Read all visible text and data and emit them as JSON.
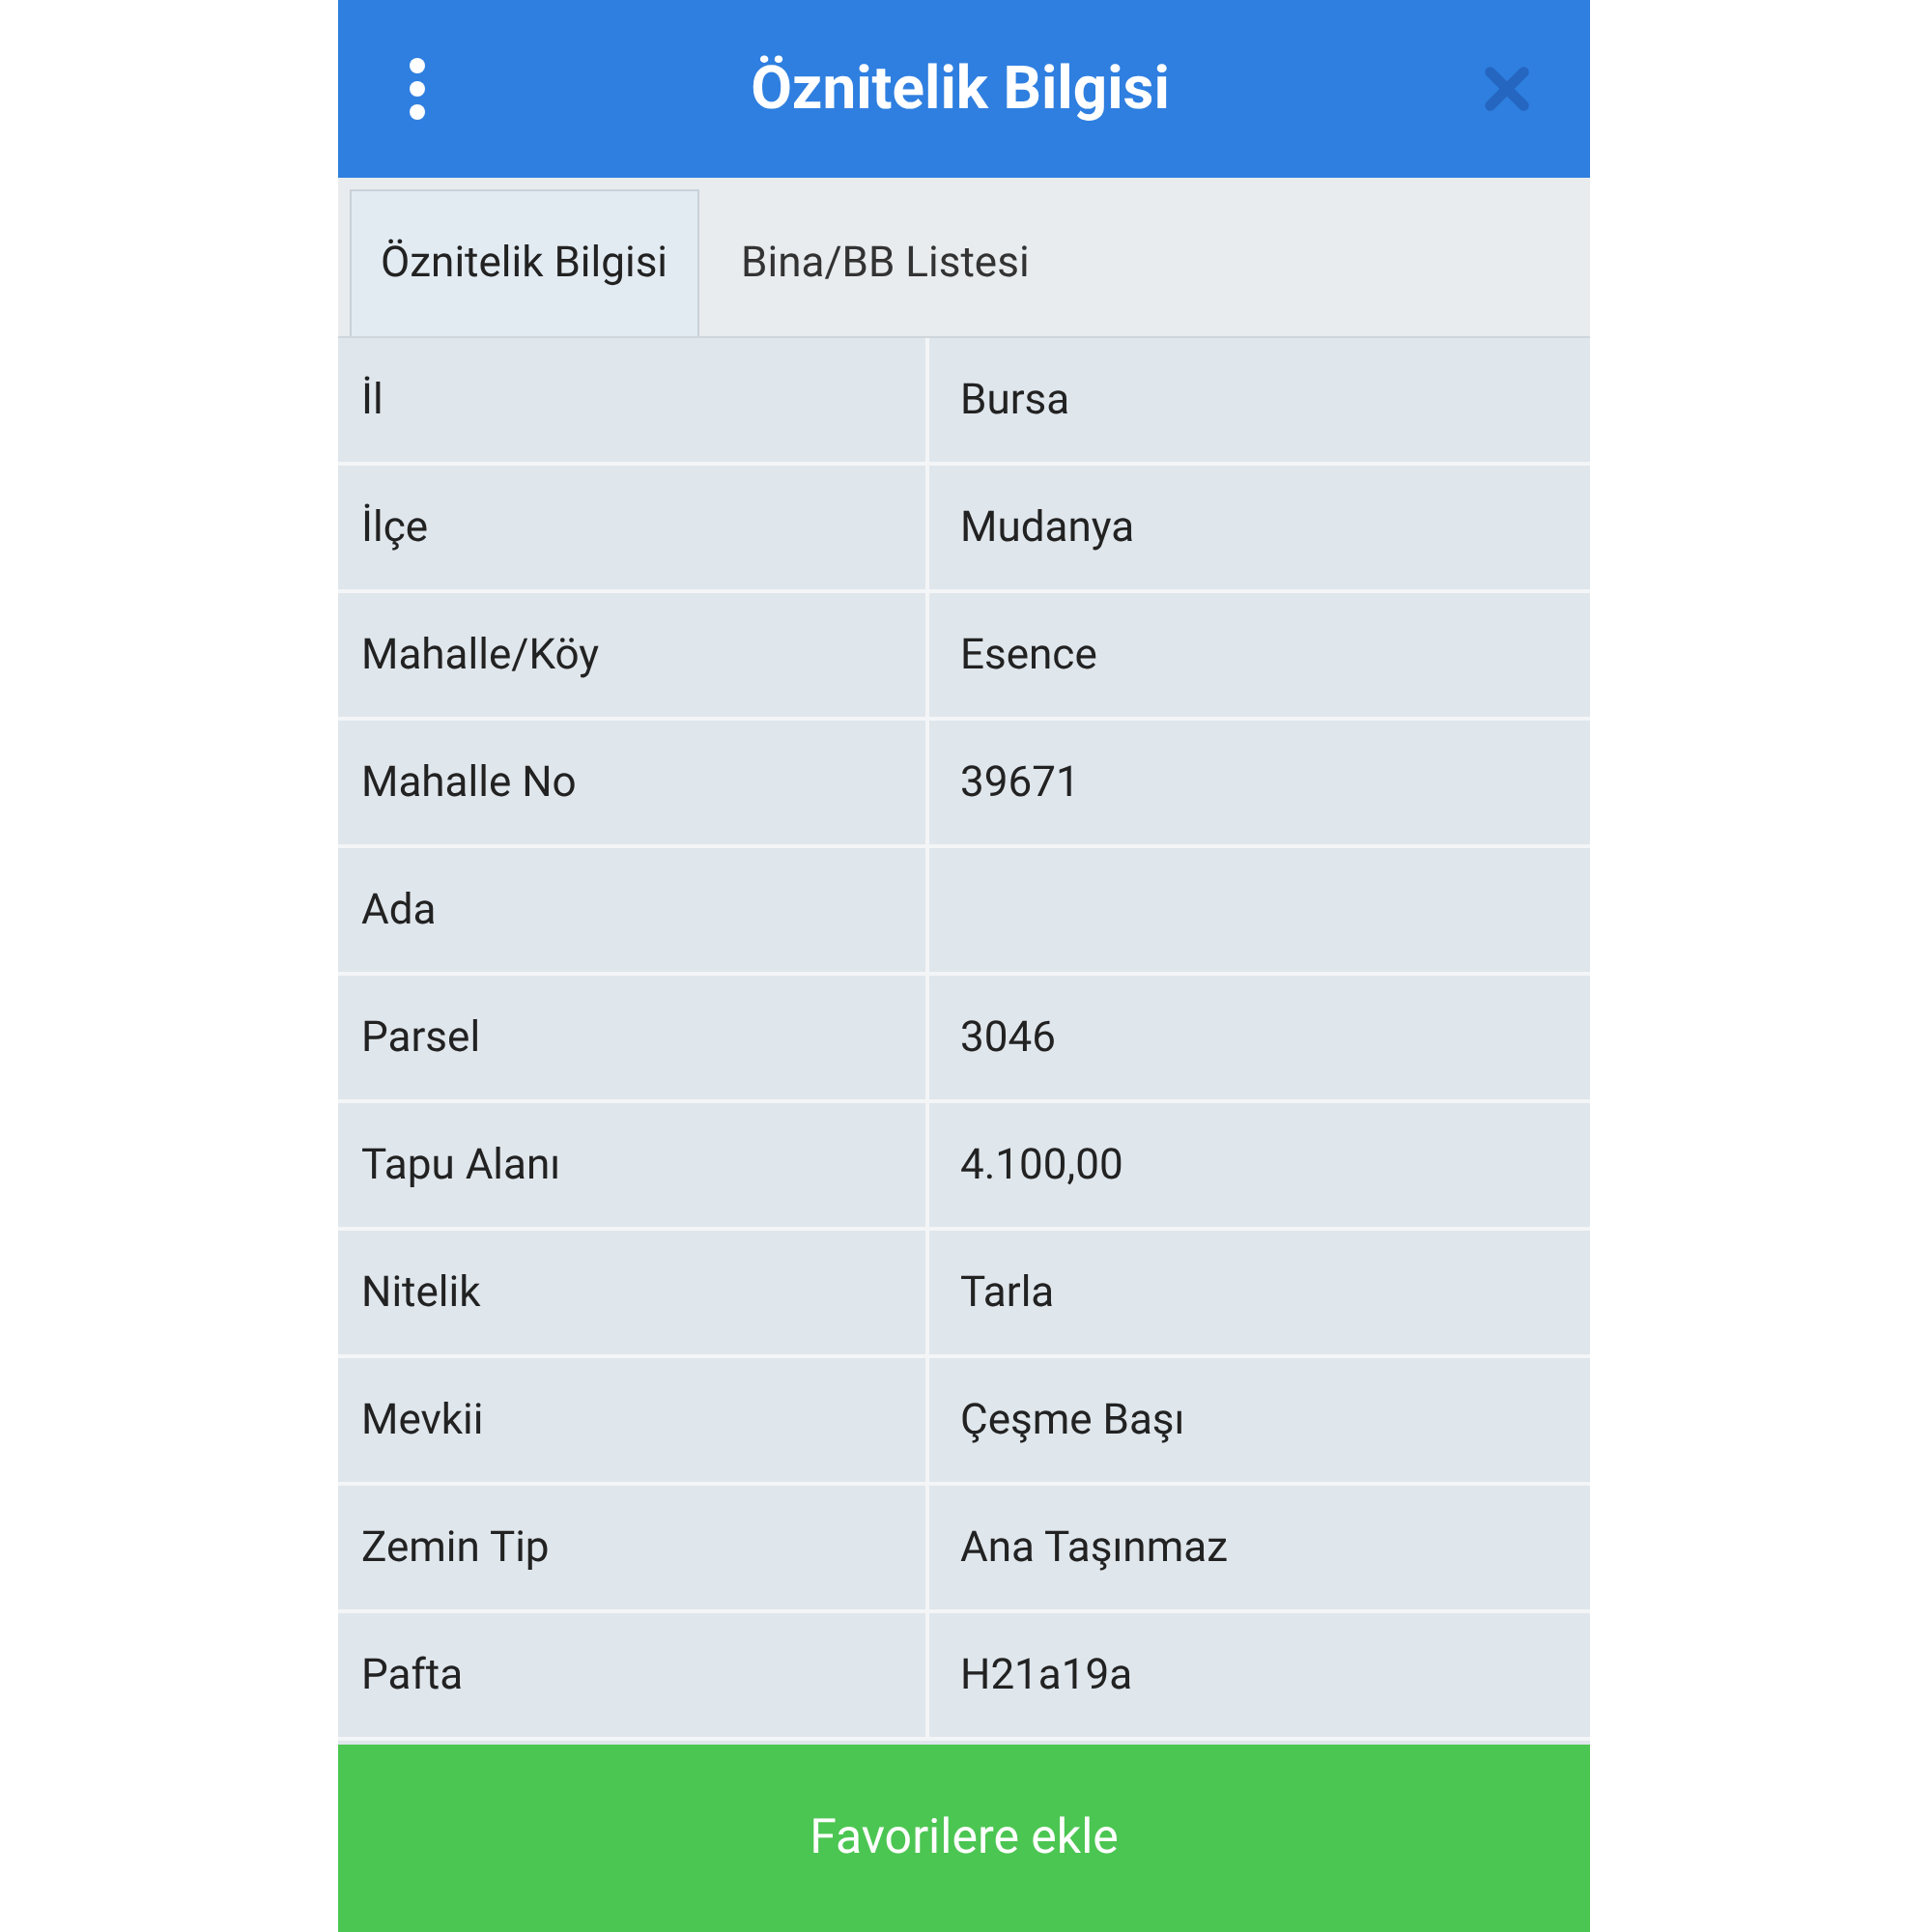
{
  "header": {
    "title": "Öznitelik Bilgisi"
  },
  "tabs": [
    {
      "label": "Öznitelik Bilgisi",
      "selected": true
    },
    {
      "label": "Bina/BB Listesi",
      "selected": false
    }
  ],
  "rows": [
    {
      "label": "İl",
      "value": "Bursa"
    },
    {
      "label": "İlçe",
      "value": "Mudanya"
    },
    {
      "label": "Mahalle/Köy",
      "value": "Esence"
    },
    {
      "label": "Mahalle No",
      "value": "39671"
    },
    {
      "label": "Ada"
    },
    {
      "label": "Parsel",
      "value": "3046"
    },
    {
      "label": "Tapu Alanı",
      "value": "4.100,00"
    },
    {
      "label": "Nitelik",
      "value": "Tarla"
    },
    {
      "label": "Mevkii",
      "value": "Çeşme Başı"
    },
    {
      "label": "Zemin Tip",
      "value": "Ana Taşınmaz"
    },
    {
      "label": "Pafta",
      "value": "H21a19a"
    }
  ],
  "footer_button": "Favorilere ekle"
}
